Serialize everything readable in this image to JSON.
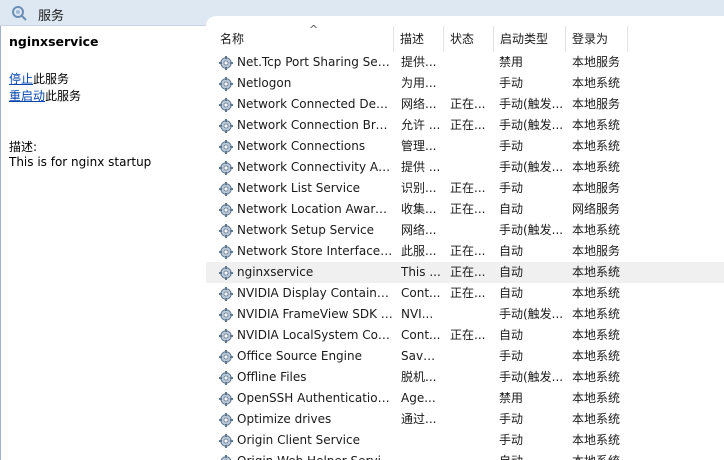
{
  "window": {
    "title": "服务",
    "icon": "services-gear-search-icon"
  },
  "left_pane": {
    "service_name": "nginxservice",
    "actions": [
      {
        "link": "停止",
        "suffix": "此服务"
      },
      {
        "link": "重启动",
        "suffix": "此服务"
      }
    ],
    "description_label": "描述:",
    "description": "This is for nginx startup"
  },
  "table": {
    "sort_indicator": "^",
    "columns": [
      "名称",
      "描述",
      "状态",
      "启动类型",
      "登录为"
    ],
    "rows": [
      {
        "name": "Net.Tcp Port Sharing Service",
        "desc": "提供...",
        "status": "",
        "startup": "禁用",
        "logon": "本地服务",
        "icon": "gear-icon"
      },
      {
        "name": "Netlogon",
        "desc": "为用...",
        "status": "",
        "startup": "手动",
        "logon": "本地系统",
        "icon": "gear-icon"
      },
      {
        "name": "Network Connected Devices Auto-Setup",
        "desc": "网络...",
        "status": "正在...",
        "startup": "手动(触发...",
        "logon": "本地服务",
        "icon": "gear-icon"
      },
      {
        "name": "Network Connection Broker",
        "desc": "允许 ...",
        "status": "正在...",
        "startup": "手动(触发...",
        "logon": "本地系统",
        "icon": "gear-icon"
      },
      {
        "name": "Network Connections",
        "desc": "管理...",
        "status": "",
        "startup": "手动",
        "logon": "本地系统",
        "icon": "gear-icon"
      },
      {
        "name": "Network Connectivity Assistant",
        "desc": "提供 ...",
        "status": "",
        "startup": "手动(触发...",
        "logon": "本地系统",
        "icon": "gear-icon"
      },
      {
        "name": "Network List Service",
        "desc": "识别...",
        "status": "正在...",
        "startup": "手动",
        "logon": "本地服务",
        "icon": "gear-icon"
      },
      {
        "name": "Network Location Awareness",
        "desc": "收集...",
        "status": "正在...",
        "startup": "自动",
        "logon": "网络服务",
        "icon": "gear-icon"
      },
      {
        "name": "Network Setup Service",
        "desc": "网络...",
        "status": "",
        "startup": "手动(触发...",
        "logon": "本地系统",
        "icon": "gear-icon"
      },
      {
        "name": "Network Store Interface Service",
        "desc": "此服...",
        "status": "正在...",
        "startup": "自动",
        "logon": "本地服务",
        "icon": "gear-icon"
      },
      {
        "name": "nginxservice",
        "desc": "This ...",
        "status": "正在...",
        "startup": "自动",
        "logon": "本地系统",
        "icon": "gear-icon",
        "selected": true
      },
      {
        "name": "NVIDIA Display Container LS",
        "desc": "Cont...",
        "status": "正在...",
        "startup": "自动",
        "logon": "本地系统",
        "icon": "gear-icon"
      },
      {
        "name": "NVIDIA FrameView SDK service",
        "desc": "NVI...",
        "status": "",
        "startup": "手动(触发...",
        "logon": "本地系统",
        "icon": "gear-icon"
      },
      {
        "name": "NVIDIA LocalSystem Container",
        "desc": "Cont...",
        "status": "正在...",
        "startup": "自动",
        "logon": "本地系统",
        "icon": "gear-icon"
      },
      {
        "name": "Office  Source Engine",
        "desc": "Save...",
        "status": "",
        "startup": "手动",
        "logon": "本地系统",
        "icon": "gear-icon"
      },
      {
        "name": "Offline Files",
        "desc": "脱机...",
        "status": "",
        "startup": "手动(触发...",
        "logon": "本地系统",
        "icon": "gear-icon"
      },
      {
        "name": "OpenSSH Authentication Agent",
        "desc": "Age...",
        "status": "",
        "startup": "禁用",
        "logon": "本地系统",
        "icon": "gear-icon"
      },
      {
        "name": "Optimize drives",
        "desc": "通过...",
        "status": "",
        "startup": "手动",
        "logon": "本地系统",
        "icon": "gear-icon"
      },
      {
        "name": "Origin Client Service",
        "desc": "",
        "status": "",
        "startup": "手动",
        "logon": "本地系统",
        "icon": "gear-icon"
      },
      {
        "name": "Origin Web Helper Service",
        "desc": "",
        "status": "",
        "startup": "自动",
        "logon": "本地系统",
        "icon": "gear-icon"
      }
    ]
  }
}
